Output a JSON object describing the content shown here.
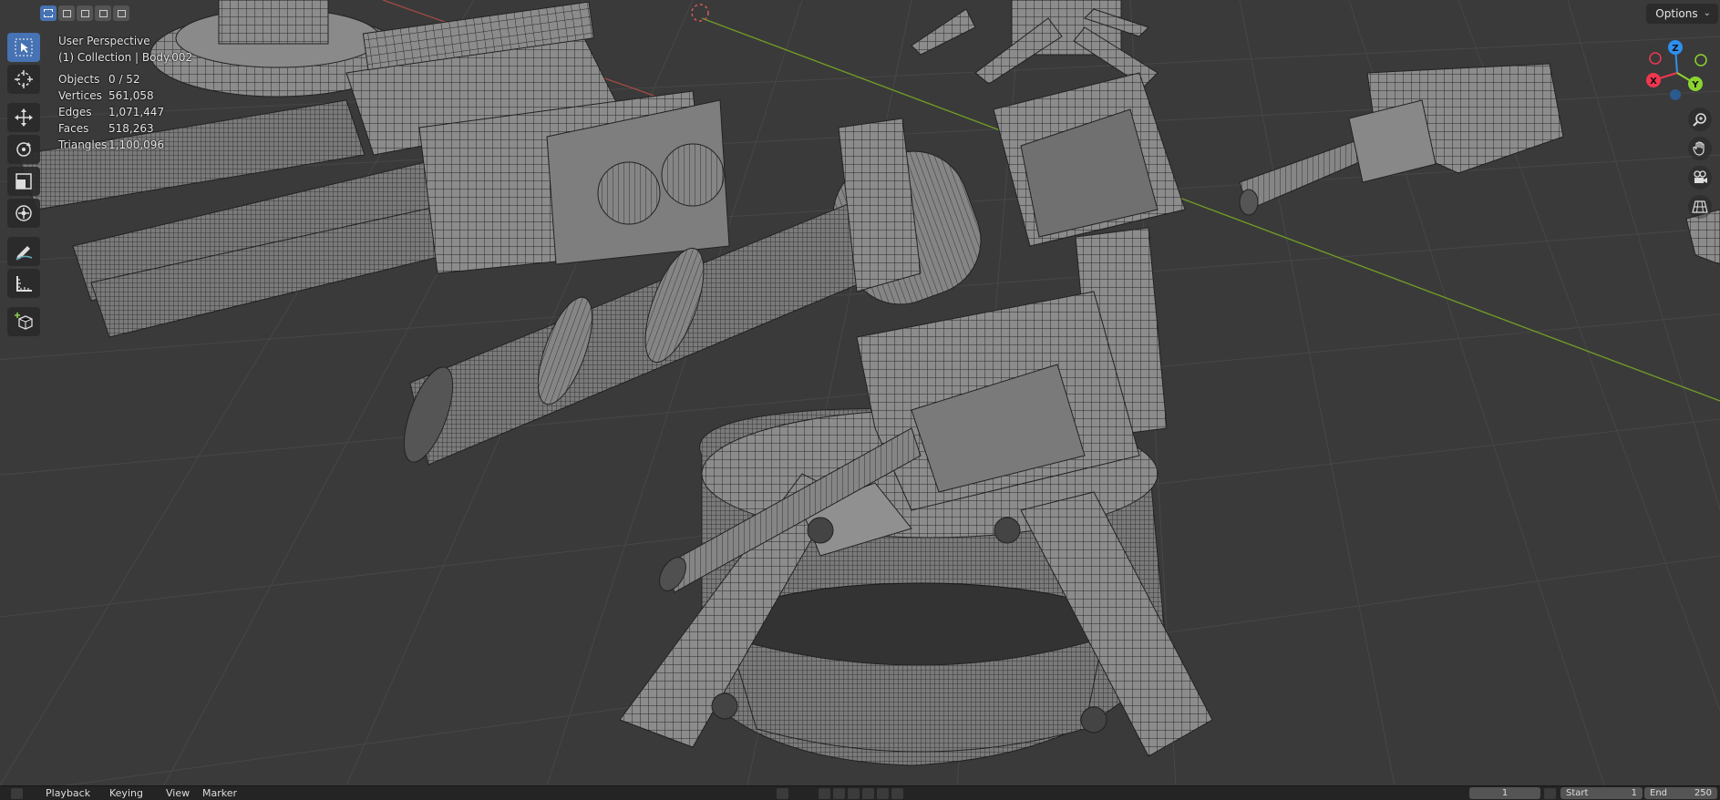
{
  "viewport": {
    "view_name": "User Perspective",
    "collection": "(1) Collection | Body.002",
    "stats": [
      {
        "label": "Objects",
        "value": "0 / 52"
      },
      {
        "label": "Vertices",
        "value": "561,058"
      },
      {
        "label": "Edges",
        "value": "1,071,447"
      },
      {
        "label": "Faces",
        "value": "518,263"
      },
      {
        "label": "Triangles",
        "value": "1,100,096"
      }
    ],
    "options_label": "Options",
    "gizmo": {
      "x": "X",
      "y": "Y",
      "z": "Z"
    }
  },
  "toolbar": {
    "tools": [
      "select-box-tool",
      "cursor-tool",
      "move-tool",
      "rotate-tool",
      "scale-tool",
      "transform-tool",
      "annotate-tool",
      "measure-tool",
      "add-cube-tool"
    ],
    "active": "select-box-tool"
  },
  "colors": {
    "background": "#3a3a3a",
    "grid": "#444444",
    "x_axis": "#b5504a",
    "y_axis": "#7aa12a",
    "accent": "#4772b3",
    "gizmo_x": "#f0374f",
    "gizmo_y": "#8bd430",
    "gizmo_z": "#2e8ff0"
  },
  "timeline": {
    "playback": "Playback",
    "keying": "Keying",
    "view": "View",
    "marker": "Marker",
    "current_frame": "1",
    "start_label": "Start",
    "start": "1",
    "end_label": "End",
    "end": "250"
  }
}
